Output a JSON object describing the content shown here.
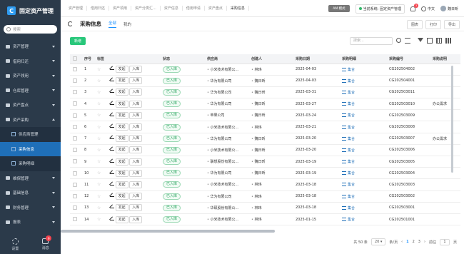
{
  "app": {
    "title": "固定资产管理"
  },
  "sidebar": {
    "search_placeholder": "搜索",
    "items": [
      {
        "label": "资产管理",
        "expanded": false
      },
      {
        "label": "借用归还",
        "expanded": false
      },
      {
        "label": "资产领用",
        "expanded": false
      },
      {
        "label": "仓库管理",
        "expanded": false
      },
      {
        "label": "资产盘点",
        "expanded": false
      },
      {
        "label": "资产采购",
        "expanded": true
      },
      {
        "label": "供应商管理",
        "sub": true
      },
      {
        "label": "采购信息",
        "sub": true,
        "active": true
      },
      {
        "label": "采购明细",
        "sub": true
      },
      {
        "label": "维保管理",
        "expanded": false
      },
      {
        "label": "基础信息",
        "expanded": false
      },
      {
        "label": "财务管理",
        "expanded": false
      },
      {
        "label": "报表",
        "expanded": false
      }
    ],
    "bottom": {
      "settings_label": "设置",
      "messages_label": "消息",
      "messages_badge": "9"
    }
  },
  "topbar": {
    "tabs": [
      "资产管理",
      "借用归还",
      "资产领用",
      "资产分类汇...",
      "资产信息",
      "借用申请",
      "资产盘点",
      "采购信息"
    ],
    "mode_chip": "AM 模式",
    "system": "当前系统: 固定资产管理",
    "notification_badge": "3",
    "language": "中文",
    "user": "魏日昕"
  },
  "page": {
    "title": "采购信息",
    "subtabs": [
      "全部",
      "我的"
    ],
    "actions": [
      "图表",
      "打印",
      "导出"
    ],
    "add_button": "新增",
    "search_placeholder": "搜索..."
  },
  "table": {
    "columns": [
      "序号",
      "标签",
      "",
      "状态",
      "供应商",
      "创建人",
      "采购日期",
      "采购明细",
      "采购编号",
      "采购说明"
    ],
    "row_buttons": [
      "发起",
      "入库"
    ],
    "rows": [
      {
        "no": "1",
        "status": "已入库",
        "supplier": "小米技术有限公...",
        "creator": "林玮",
        "date": "2025-04-03",
        "detail": "集合",
        "code": "CG202504002",
        "note": ""
      },
      {
        "no": "2",
        "status": "已入库",
        "supplier": "华为有限公司",
        "creator": "魏日昕",
        "date": "2025-04-03",
        "detail": "集合",
        "code": "CG202504001",
        "note": ""
      },
      {
        "no": "3",
        "status": "已入库",
        "supplier": "华为有限公司",
        "creator": "魏日昕",
        "date": "2025-03-31",
        "detail": "集合",
        "code": "CG202503011",
        "note": ""
      },
      {
        "no": "4",
        "status": "已入库",
        "supplier": "华为有限公司",
        "creator": "魏日昕",
        "date": "2025-03-27",
        "detail": "集合",
        "code": "CG202503010",
        "note": "办公需求"
      },
      {
        "no": "5",
        "status": "已入库",
        "supplier": "苹果公司",
        "creator": "魏日昕",
        "date": "2025-03-24",
        "detail": "集合",
        "code": "CG202503009",
        "note": ""
      },
      {
        "no": "6",
        "status": "已入库",
        "supplier": "小米技术有限公...",
        "creator": "林玮",
        "date": "2025-03-21",
        "detail": "集合",
        "code": "CG202503008",
        "note": ""
      },
      {
        "no": "7",
        "status": "已入库",
        "supplier": "华为有限公司",
        "creator": "魏日昕",
        "date": "2025-03-20",
        "detail": "集合",
        "code": "CG202503007",
        "note": "办公需求"
      },
      {
        "no": "8",
        "status": "已入库",
        "supplier": "小米技术有限公...",
        "creator": "魏日昕",
        "date": "2025-03-20",
        "detail": "集合",
        "code": "CG202503006",
        "note": ""
      },
      {
        "no": "9",
        "status": "已入库",
        "supplier": "联想股份有限公...",
        "creator": "魏日昕",
        "date": "2025-03-19",
        "detail": "集合",
        "code": "CG202503005",
        "note": ""
      },
      {
        "no": "10",
        "status": "已入库",
        "supplier": "华为有限公司",
        "creator": "魏日昕",
        "date": "2025-03-19",
        "detail": "集合",
        "code": "CG202503004",
        "note": ""
      },
      {
        "no": "11",
        "status": "已入库",
        "supplier": "小米技术有限公...",
        "creator": "林玮",
        "date": "2025-03-18",
        "detail": "集合",
        "code": "CG202503003",
        "note": ""
      },
      {
        "no": "12",
        "status": "已入库",
        "supplier": "华为有限公司",
        "creator": "林玮",
        "date": "2025-03-18",
        "detail": "集合",
        "code": "CG202503002",
        "note": ""
      },
      {
        "no": "13",
        "status": "已入库",
        "supplier": "华硕股份有限公...",
        "creator": "林玮",
        "date": "2025-03-18",
        "detail": "集合",
        "code": "CG202503001",
        "note": ""
      },
      {
        "no": "14",
        "status": "已入库",
        "supplier": "小米技术有限公...",
        "creator": "林玮",
        "date": "2025-01-15",
        "detail": "集合",
        "code": "CG202501001",
        "note": ""
      }
    ]
  },
  "pager": {
    "total": "共 50 条",
    "page_size": "20",
    "page_size_suffix": "条/页",
    "pages": [
      "1",
      "2",
      "3"
    ],
    "current": "1",
    "goto_label": "前往",
    "goto_value": "1",
    "goto_suffix": "页"
  }
}
